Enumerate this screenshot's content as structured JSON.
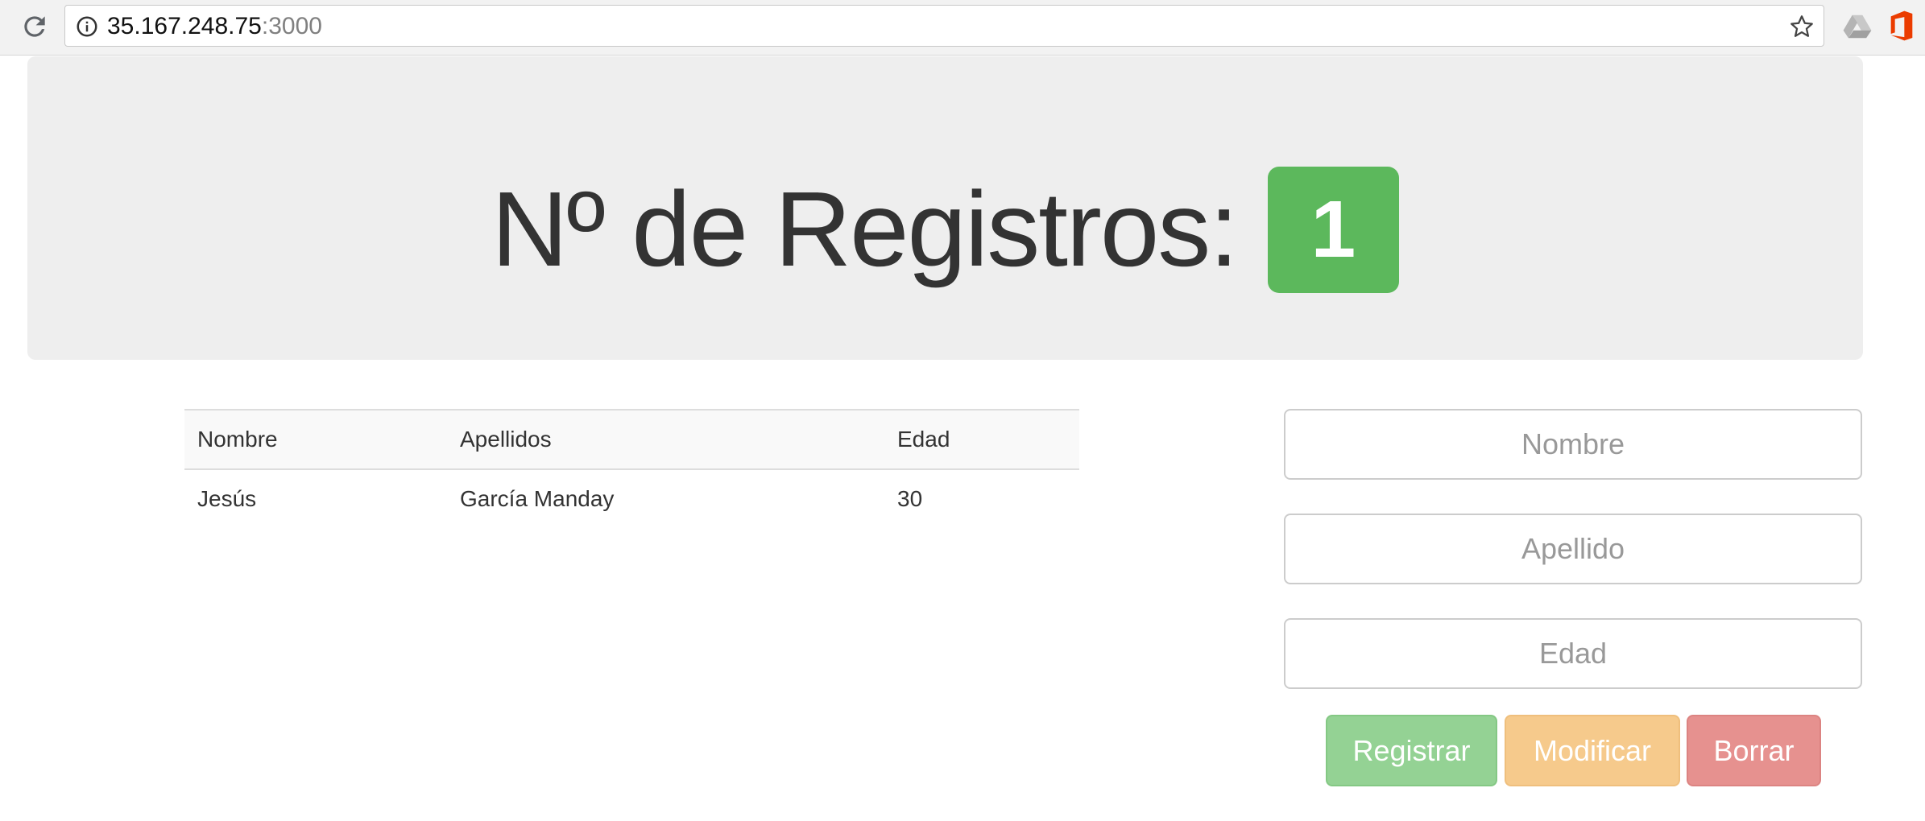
{
  "browser": {
    "url_host": "35.167.248.75",
    "url_port": ":3000"
  },
  "jumbotron": {
    "title": "Nº de Registros:",
    "count": "1",
    "badge_color": "#5cb85c"
  },
  "table": {
    "headers": [
      "Nombre",
      "Apellidos",
      "Edad"
    ],
    "rows": [
      [
        "Jesús",
        "García Manday",
        "30"
      ]
    ]
  },
  "form": {
    "nombre_placeholder": "Nombre",
    "apellido_placeholder": "Apellido",
    "edad_placeholder": "Edad",
    "registrar_label": "Registrar",
    "modificar_label": "Modificar",
    "borrar_label": "Borrar"
  },
  "colors": {
    "registrar": "#94d294",
    "modificar": "#f6ca8c",
    "borrar": "#e6918f"
  },
  "icons": {
    "reload": "reload-icon",
    "info": "info-icon",
    "bookmark": "star-icon",
    "drive": "google-drive-icon",
    "office": "office-icon"
  }
}
